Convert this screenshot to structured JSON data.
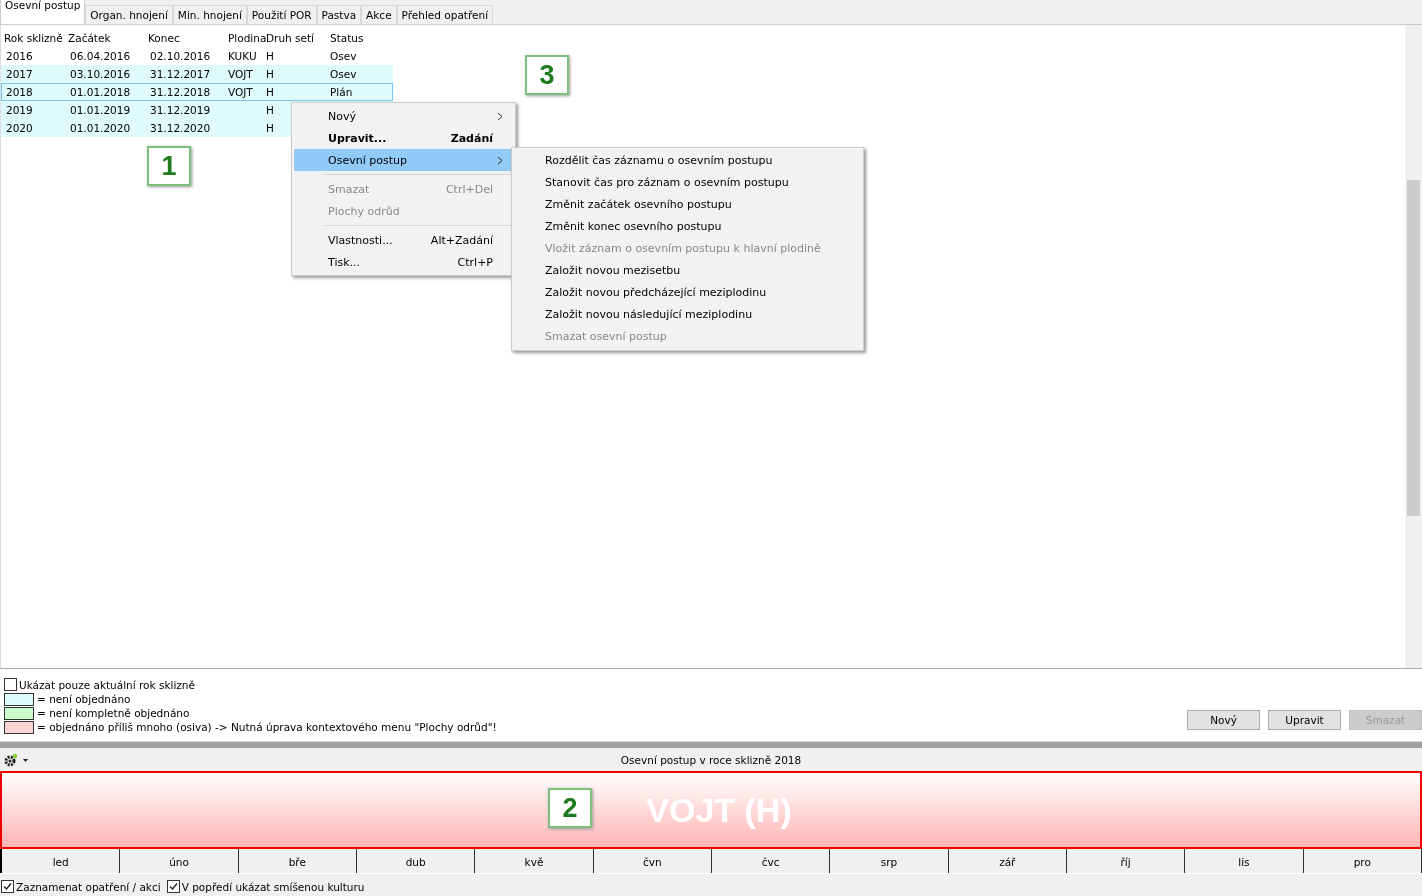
{
  "tabs": [
    {
      "label": "Osevní postup",
      "selected": true
    },
    {
      "label": "Organ. hnojení",
      "selected": false
    },
    {
      "label": "Min. hnojení",
      "selected": false
    },
    {
      "label": "Použití POR",
      "selected": false
    },
    {
      "label": "Pastva",
      "selected": false
    },
    {
      "label": "Akce",
      "selected": false
    },
    {
      "label": "Přehled opatření",
      "selected": false
    }
  ],
  "table": {
    "columns": [
      "Rok sklizně",
      "Začátek",
      "Konec",
      "Plodina",
      "Druh setí",
      "Status"
    ],
    "rows": [
      {
        "cells": [
          "2016",
          "06.04.2016",
          "02.10.2016",
          "KUKU",
          "H",
          "Osev"
        ],
        "color": "#ffffff",
        "selected": false
      },
      {
        "cells": [
          "2017",
          "03.10.2016",
          "31.12.2017",
          "VOJT",
          "H",
          "Osev"
        ],
        "color": "#dffafa",
        "selected": false
      },
      {
        "cells": [
          "2018",
          "01.01.2018",
          "31.12.2018",
          "VOJT",
          "H",
          "Plán"
        ],
        "color": "#dffafa",
        "selected": true
      },
      {
        "cells": [
          "2019",
          "01.01.2019",
          "31.12.2019",
          "",
          "H",
          ""
        ],
        "color": "#dffafa",
        "selected": false
      },
      {
        "cells": [
          "2020",
          "01.01.2020",
          "31.12.2020",
          "",
          "H",
          ""
        ],
        "color": "#dffafa",
        "selected": false
      }
    ]
  },
  "context_menu": {
    "groups": [
      [
        {
          "label": "Nový",
          "kind": "submenu",
          "disabled": false,
          "selected": false
        },
        {
          "label": "Upravit...",
          "shortcut": "Zadání",
          "kind": "default",
          "disabled": false,
          "selected": false
        },
        {
          "label": "Osevní postup",
          "kind": "submenu",
          "disabled": false,
          "selected": true
        }
      ],
      [
        {
          "label": "Smazat",
          "shortcut": "Ctrl+Del",
          "kind": "command",
          "disabled": true,
          "selected": false
        },
        {
          "label": "Plochy odrůd",
          "kind": "command",
          "disabled": true,
          "selected": false
        }
      ],
      [
        {
          "label": "Vlastnosti...",
          "shortcut": "Alt+Zadání",
          "kind": "command",
          "disabled": false,
          "selected": false
        },
        {
          "label": "Tisk...",
          "shortcut": "Ctrl+P",
          "kind": "command",
          "disabled": false,
          "selected": false
        }
      ]
    ]
  },
  "submenu": {
    "items": [
      {
        "label": "Rozdělit čas záznamu o osevním postupu",
        "disabled": false
      },
      {
        "label": "Stanovit čas pro záznam o osevním postupu",
        "disabled": false
      },
      {
        "label": "Změnit začátek osevního postupu",
        "disabled": false
      },
      {
        "label": "Změnit konec osevního postupu",
        "disabled": false
      },
      {
        "label": "Vložit záznam o osevním postupu k hlavní plodině",
        "disabled": true
      },
      {
        "label": "Založit novou mezisetbu",
        "disabled": false
      },
      {
        "label": "Založit novou předcházející meziplodinu",
        "disabled": false
      },
      {
        "label": "Založit novou následující meziplodinu",
        "disabled": false
      },
      {
        "label": "Smazat osevní postup",
        "disabled": true
      }
    ]
  },
  "callouts": [
    "1",
    "2",
    "3"
  ],
  "current_year_only": {
    "label": "Ukázat pouze aktuální rok sklizně",
    "checked": false
  },
  "legend": [
    {
      "color": "#dffafa",
      "label": "= není objednáno"
    },
    {
      "color": "#ccfccc",
      "label": "= není kompletně objednáno"
    },
    {
      "color": "#fcd4d4",
      "label": "= objednáno příliš mnoho (osiva) -> Nutná úprava kontextového menu \"Plochy odrůd\"!"
    }
  ],
  "buttons": [
    {
      "label": "Nový",
      "disabled": false
    },
    {
      "label": "Upravit",
      "disabled": false
    },
    {
      "label": "Smazat",
      "disabled": true
    }
  ],
  "timeline": {
    "title": "Osevní postup v roce sklizně 2018",
    "bar_label": "VOJT (H)",
    "months": [
      "led",
      "úno",
      "bře",
      "dub",
      "kvě",
      "čvn",
      "čvc",
      "srp",
      "zář",
      "říj",
      "lis",
      "pro"
    ]
  },
  "options": [
    {
      "label": "Zaznamenat opatření / akci",
      "checked": true
    },
    {
      "label": "V popředí ukázat smíšenou kulturu",
      "checked": true
    }
  ]
}
